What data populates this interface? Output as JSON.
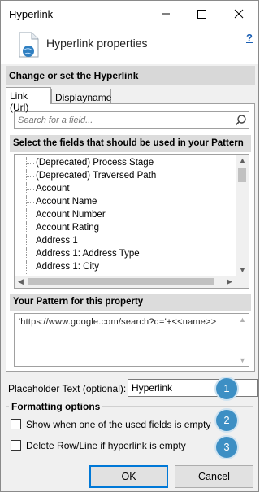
{
  "window": {
    "title": "Hyperlink"
  },
  "header": {
    "title": "Hyperlink properties",
    "help": "?"
  },
  "group": {
    "title": "Change or set the Hyperlink"
  },
  "tabs": [
    {
      "label": "Link (Url)",
      "active": true
    },
    {
      "label": "Displayname",
      "active": false
    }
  ],
  "search": {
    "placeholder": "Search for a field..."
  },
  "fields": {
    "title": "Select the fields that should be used in your Pattern",
    "items": [
      "(Deprecated) Process Stage",
      "(Deprecated) Traversed Path",
      "Account",
      "Account Name",
      "Account Number",
      "Account Rating",
      "Address 1",
      "Address 1: Address Type",
      "Address 1: City"
    ]
  },
  "pattern": {
    "title": "Your Pattern for this property",
    "value": "'https://www.google.com/search?q='+<<name>>"
  },
  "placeholder": {
    "label": "Placeholder Text (optional):",
    "value": "Hyperlink"
  },
  "formatting": {
    "title": "Formatting options",
    "options": [
      {
        "label": "Show when one of the used fields is empty",
        "checked": false
      },
      {
        "label": "Delete Row/Line if hyperlink is empty",
        "checked": false
      }
    ]
  },
  "badges": [
    "1",
    "2",
    "3"
  ],
  "buttons": {
    "ok": "OK",
    "cancel": "Cancel"
  },
  "icons": {
    "minimize": "minimize-icon",
    "maximize": "maximize-icon",
    "close": "close-icon",
    "header": "document-globe-icon",
    "search": "search-icon"
  },
  "colors": {
    "badge": "#3d8fc4",
    "link": "#1a5fb4",
    "band": "#d8d8d8"
  }
}
